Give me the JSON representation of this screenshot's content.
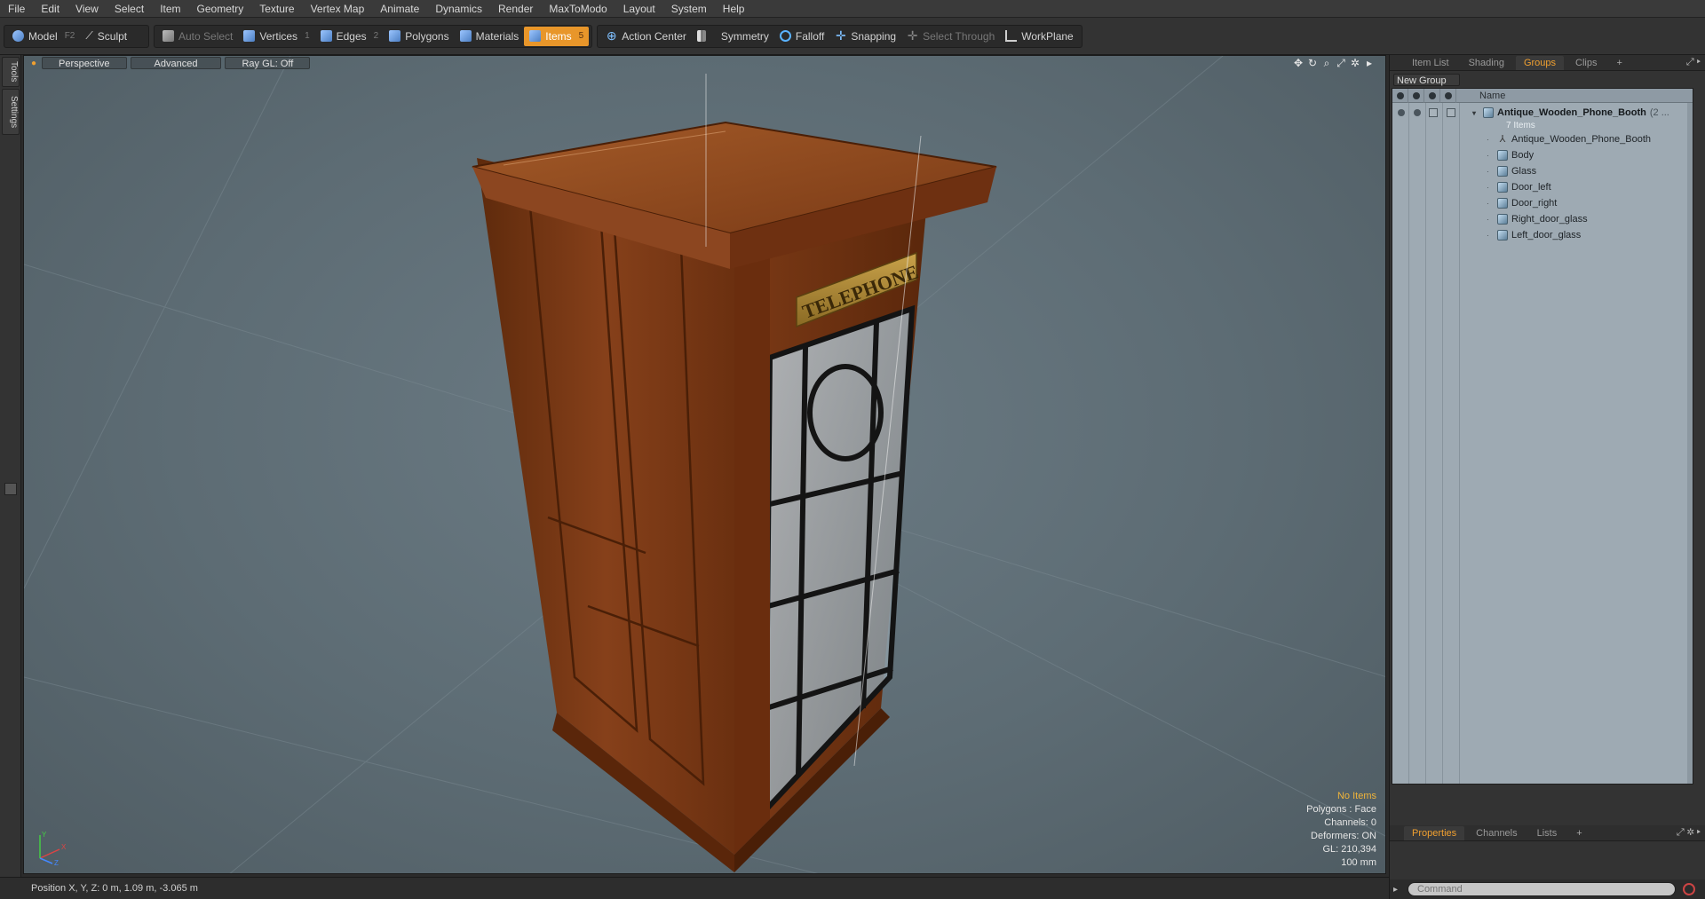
{
  "menu": [
    "File",
    "Edit",
    "View",
    "Select",
    "Item",
    "Geometry",
    "Texture",
    "Vertex Map",
    "Animate",
    "Dynamics",
    "Render",
    "MaxToModo",
    "Layout",
    "System",
    "Help"
  ],
  "toolbar": {
    "model": "Model",
    "model_key": "F2",
    "sculpt": "Sculpt",
    "auto_select": "Auto Select",
    "vertices": "Vertices",
    "vertices_key": "1",
    "edges": "Edges",
    "edges_key": "2",
    "polygons": "Polygons",
    "materials": "Materials",
    "items": "Items",
    "items_key": "5",
    "action_center": "Action Center",
    "symmetry": "Symmetry",
    "falloff": "Falloff",
    "snapping": "Snapping",
    "select_through": "Select Through",
    "workplane": "WorkPlane"
  },
  "left_tabs": {
    "tools": "Tools",
    "settings": "Settings"
  },
  "viewport": {
    "view": "Perspective",
    "shading": "Advanced",
    "raygl": "Ray GL: Off",
    "sign_text": "TELEPHONE",
    "stats": {
      "selection": "No Items",
      "polygons": "Polygons : Face",
      "channels": "Channels: 0",
      "deformers": "Deformers: ON",
      "gl": "GL: 210,394",
      "grid": "100 mm"
    },
    "axes": {
      "x": "X",
      "y": "Y",
      "z": "Z"
    }
  },
  "status_bar": {
    "position": "Position X, Y, Z:  0 m, 1.09 m, -3.065 m"
  },
  "right_panel": {
    "top_tabs": [
      "Item List",
      "Shading",
      "Groups",
      "Clips"
    ],
    "active_top_tab": "Groups",
    "new_group": "New Group",
    "name_header": "Name",
    "group": {
      "name": "Antique_Wooden_Phone_Booth",
      "count_suffix": "(2 ...",
      "items_label": "7 Items",
      "children": [
        "Antique_Wooden_Phone_Booth",
        "Body",
        "Glass",
        "Door_left",
        "Door_right",
        "Right_door_glass",
        "Left_door_glass"
      ]
    },
    "bottom_tabs": [
      "Properties",
      "Channels",
      "Lists"
    ],
    "active_bottom_tab": "Properties",
    "command_placeholder": "Command"
  },
  "colors": {
    "accent": "#e8962a",
    "viewport_bg": "#5f6e76",
    "wood": "#7a3a14",
    "tree_bg": "#9eaab3"
  }
}
